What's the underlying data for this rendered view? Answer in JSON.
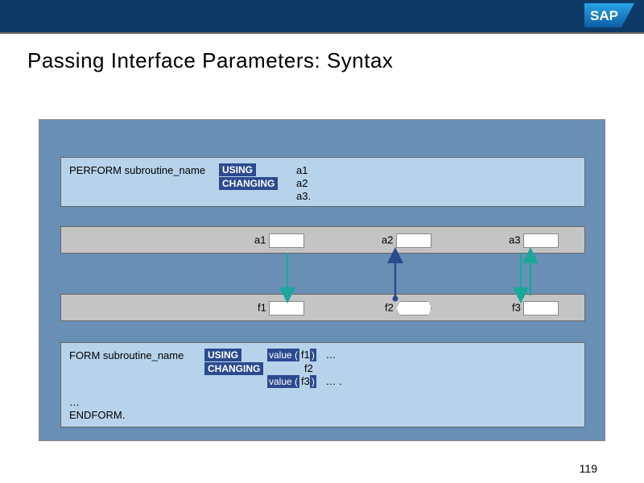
{
  "header": {
    "logo_text": "SAP"
  },
  "title": "Passing Interface Parameters: Syntax",
  "perform": {
    "keyword": "PERFORM subroutine_name",
    "using": "USING",
    "changing": "CHANGING",
    "p1": "a1",
    "p2": "a2",
    "p3": "a3."
  },
  "row_a": {
    "v1": "a1",
    "v2": "a2",
    "v3": "a3"
  },
  "row_f": {
    "v1": "f1",
    "v2": "f2",
    "v3": "f3"
  },
  "form": {
    "keyword": "FORM subroutine_name",
    "using": "USING",
    "changing": "CHANGING",
    "value_open": "value (",
    "close": ")",
    "f1": "f1",
    "f2": "f2",
    "f3": "f3",
    "dots1": "…",
    "dots2": "… .",
    "ellipsis": "…",
    "end": "ENDFORM."
  },
  "page": "119"
}
